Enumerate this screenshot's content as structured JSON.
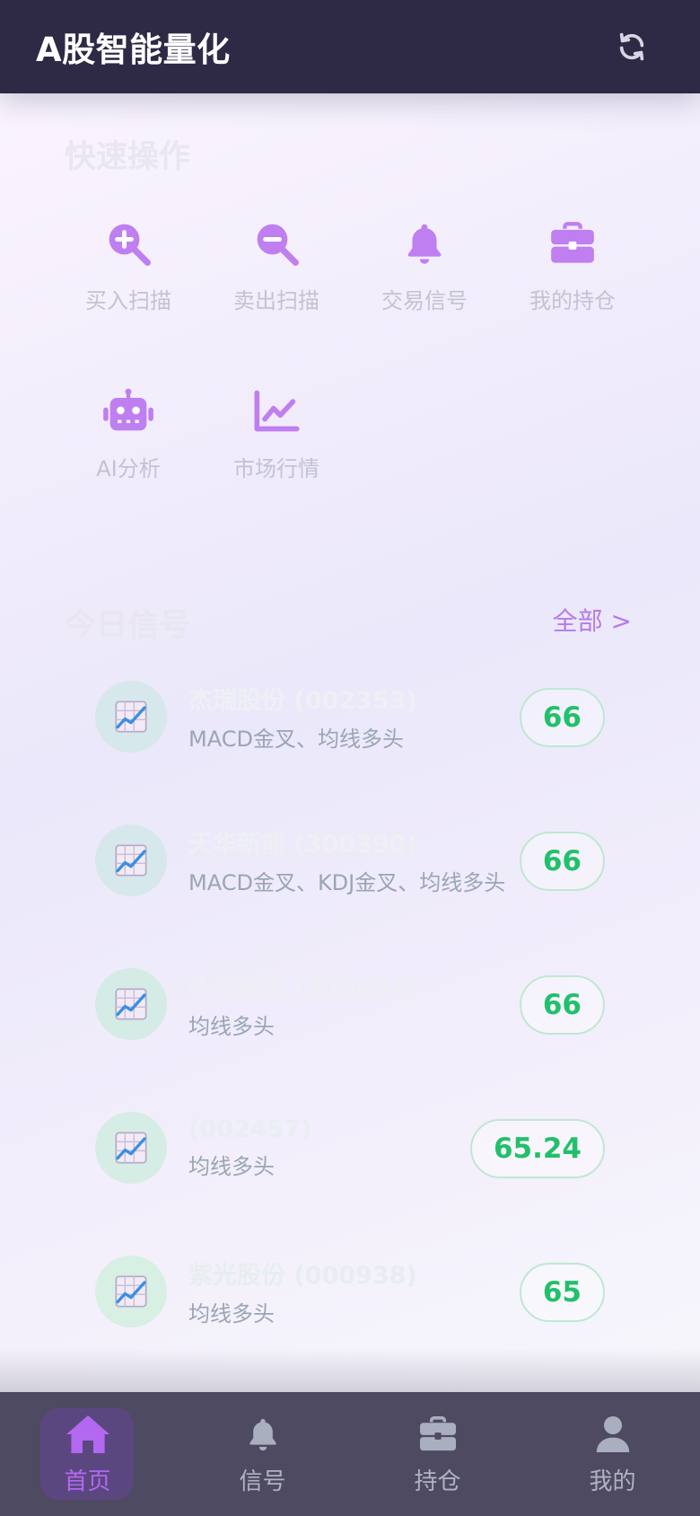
{
  "header": {
    "title": "A股智能量化"
  },
  "quick_actions": {
    "title": "快速操作",
    "items": [
      {
        "label": "买入扫描",
        "icon": "zoom-in-icon"
      },
      {
        "label": "卖出扫描",
        "icon": "zoom-out-icon"
      },
      {
        "label": "交易信号",
        "icon": "bell-icon"
      },
      {
        "label": "我的持仓",
        "icon": "briefcase-icon"
      },
      {
        "label": "AI分析",
        "icon": "robot-icon"
      },
      {
        "label": "市场行情",
        "icon": "line-chart-icon"
      }
    ]
  },
  "signals": {
    "title": "今日信号",
    "see_all": "全部 >",
    "items": [
      {
        "name": "杰瑞股份 (002353)",
        "desc": "MACD金叉、均线多头",
        "score": "66"
      },
      {
        "name": "天华新能 (300390)",
        "desc": "MACD金叉、KDJ金叉、均线多头",
        "score": "66"
      },
      {
        "name": "中石科技 (300684)",
        "desc": "均线多头",
        "score": "66"
      },
      {
        "name": "(002457)",
        "desc": "均线多头",
        "score": "65.24"
      },
      {
        "name": "紫光股份 (000938)",
        "desc": "均线多头",
        "score": "65"
      }
    ]
  },
  "tabbar": {
    "items": [
      {
        "label": "首页",
        "icon": "home-icon",
        "active": true
      },
      {
        "label": "信号",
        "icon": "bell-icon"
      },
      {
        "label": "持仓",
        "icon": "briefcase-icon"
      },
      {
        "label": "我的",
        "icon": "user-icon"
      }
    ]
  },
  "colors": {
    "header_bg": "#2e2a45",
    "accent": "#b368f0",
    "icon_purple": "#bf7ff0",
    "score_green": "#22c06a",
    "tabbar_bg": "#4e4a62"
  }
}
